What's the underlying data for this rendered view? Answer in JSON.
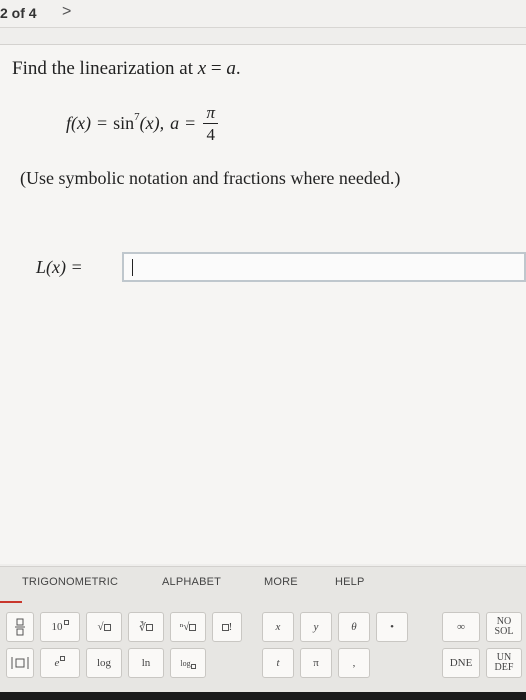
{
  "nav": {
    "counter": "2 of 4",
    "next_arrow": ">"
  },
  "question": {
    "prompt_text": "Find the linearization at ",
    "prompt_var": "x",
    "prompt_eq": " = ",
    "prompt_a": "a",
    "prompt_end": ".",
    "func_lhs": "f(x)",
    "equals": "=",
    "func_name": "sin",
    "func_power": "7",
    "func_arg": "(x),",
    "a_var": "a",
    "a_eq": "=",
    "a_num": "π",
    "a_den": "4",
    "note": "(Use symbolic notation and fractions where needed.)"
  },
  "answer": {
    "label": "L(x) =",
    "value": ""
  },
  "palette": {
    "tabs": [
      "TRIGONOMETRIC",
      "ALPHABET",
      "MORE",
      "HELP"
    ],
    "row1": [
      "10",
      "√",
      "∛",
      "ⁿ√",
      "!",
      "x",
      "y",
      "θ",
      "•",
      "∞",
      "NO",
      "SOL"
    ],
    "row2": [
      "e",
      "log",
      "ln",
      "log",
      "t",
      "π",
      ",",
      "DNE",
      "UN",
      "DEF"
    ]
  }
}
